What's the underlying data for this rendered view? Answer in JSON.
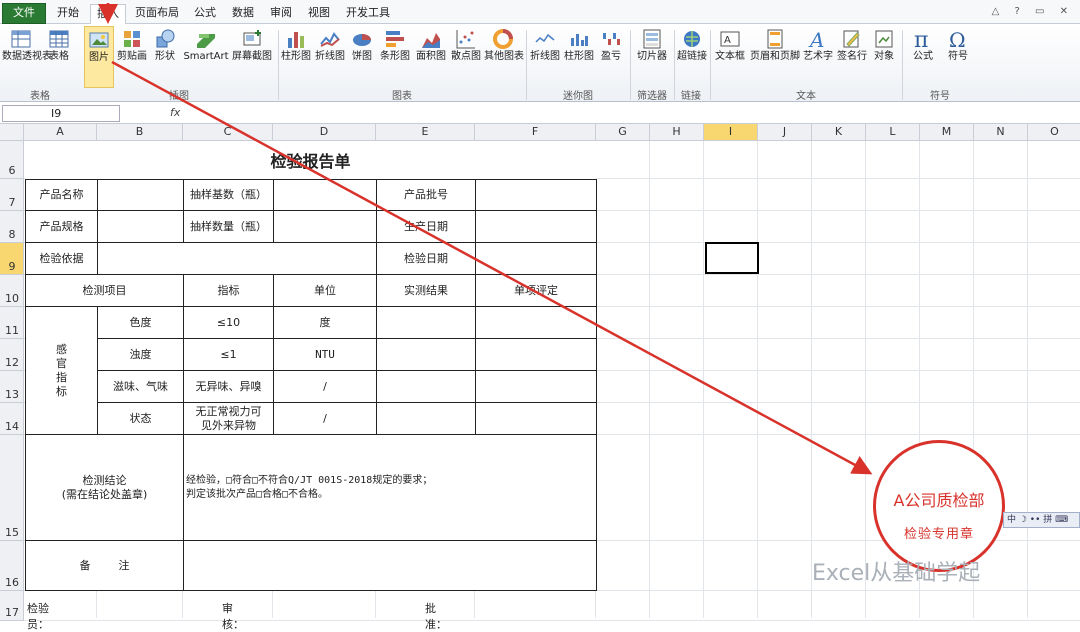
{
  "ribbon_tabs": [
    "文件",
    "开始",
    "插入",
    "页面布局",
    "公式",
    "数据",
    "审阅",
    "视图",
    "开发工具"
  ],
  "ribbon_buttons": [
    "数据透视表",
    "表格",
    "图片",
    "剪贴画",
    "形状",
    "SmartArt",
    "屏幕截图",
    "柱形图",
    "折线图",
    "饼图",
    "条形图",
    "面积图",
    "散点图",
    "其他图表",
    "折线图",
    "柱形图",
    "盈亏",
    "切片器",
    "超链接",
    "文本框",
    "页眉和页脚",
    "艺术字",
    "签名行",
    "对象",
    "公式",
    "符号"
  ],
  "ribbon_groups": [
    "表格",
    "插图",
    "图表",
    "迷你图",
    "筛选器",
    "链接",
    "文本",
    "符号"
  ],
  "name_box": "I9",
  "fx_label": "fx",
  "columns": [
    "A",
    "B",
    "C",
    "D",
    "E",
    "F",
    "G",
    "H",
    "I",
    "J",
    "K",
    "L",
    "M",
    "N",
    "O"
  ],
  "rows": [
    "6",
    "7",
    "8",
    "9",
    "10",
    "11",
    "12",
    "13",
    "14",
    "15",
    "16",
    "17"
  ],
  "report": {
    "title": "检验报告单",
    "product_name": "产品名称",
    "sample_base": "抽样基数（瓶）",
    "batch_no": "产品批号",
    "product_spec": "产品规格",
    "sample_qty": "抽样数量（瓶）",
    "prod_date": "生产日期",
    "basis": "检验依据",
    "test_date": "检验日期",
    "item_header": "检测项目",
    "index_header": "指标",
    "unit_header": "单位",
    "result_header": "实测结果",
    "judge_header": "单项评定",
    "sense_label": "感\n官\n指\n标",
    "items": [
      {
        "name": "色度",
        "index": "≤10",
        "unit": "度"
      },
      {
        "name": "浊度",
        "index": "≤1",
        "unit": "NTU"
      },
      {
        "name": "滋味、气味",
        "index": "无异味、异嗅",
        "unit": "/"
      },
      {
        "name": "状态",
        "index": "无正常视力可\n见外来异物",
        "unit": "/"
      }
    ],
    "conclusion_label": "检测结论\n(需在结论处盖章)",
    "conclusion_text": "经检验，□符合□不符合Q/JT 001S-2018规定的要求；\n判定该批次产品□合格□不合格。",
    "remark_label": "备        注",
    "inspector": "检验员：",
    "reviewer": "审核：",
    "approver": "批准："
  },
  "stamp": {
    "line1": "A公司质检部",
    "line2": "检验专用章"
  },
  "ime_bar": "中 ☽ •• 拼 ⌨",
  "watermark": "Excel从基础学起",
  "colors": {
    "file_tab": "#2a7a34",
    "arrow": "#d8322b",
    "stamp": "#d8322b",
    "selected_header": "#f8d770"
  }
}
